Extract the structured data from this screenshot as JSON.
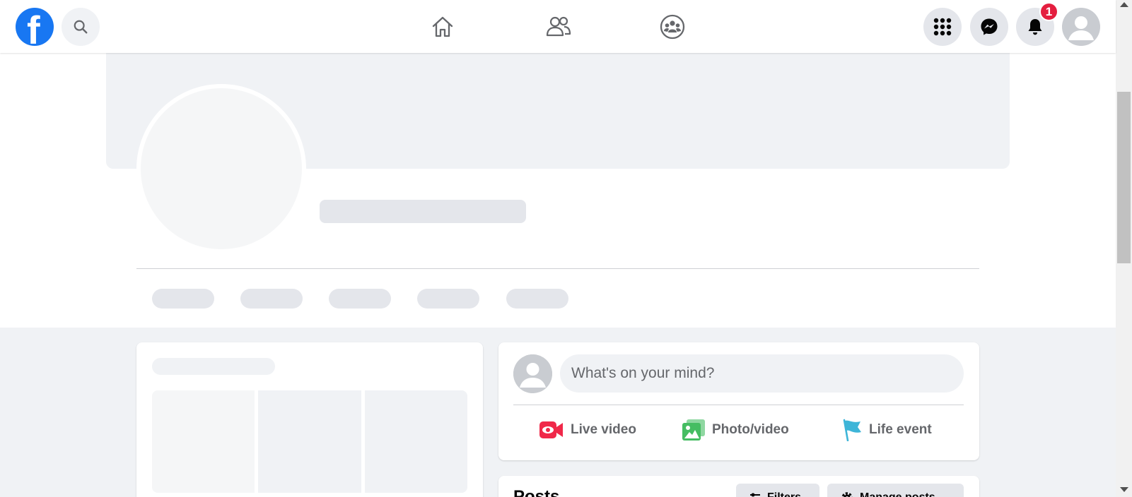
{
  "nav": {
    "logo_letter": "f",
    "notification_count": "1",
    "icons": [
      "facebook-logo",
      "search-icon",
      "home-icon",
      "friends-icon",
      "groups-icon",
      "menu-grid-icon",
      "messenger-icon",
      "bell-icon",
      "account-avatar"
    ]
  },
  "composer": {
    "placeholder": "What's on your mind?",
    "actions": [
      {
        "label": "Live video",
        "icon": "live-video-icon",
        "color": "#f02849"
      },
      {
        "label": "Photo/video",
        "icon": "photo-icon",
        "color": "#45bd62"
      },
      {
        "label": "Life event",
        "icon": "flag-icon",
        "color": "#3eb5d8"
      }
    ]
  },
  "posts": {
    "title": "Posts",
    "filters_label": "Filters",
    "manage_label": "Manage posts"
  },
  "colors": {
    "brand": "#1877f2",
    "badge": "#e41e3f",
    "background": "#f0f2f5"
  }
}
